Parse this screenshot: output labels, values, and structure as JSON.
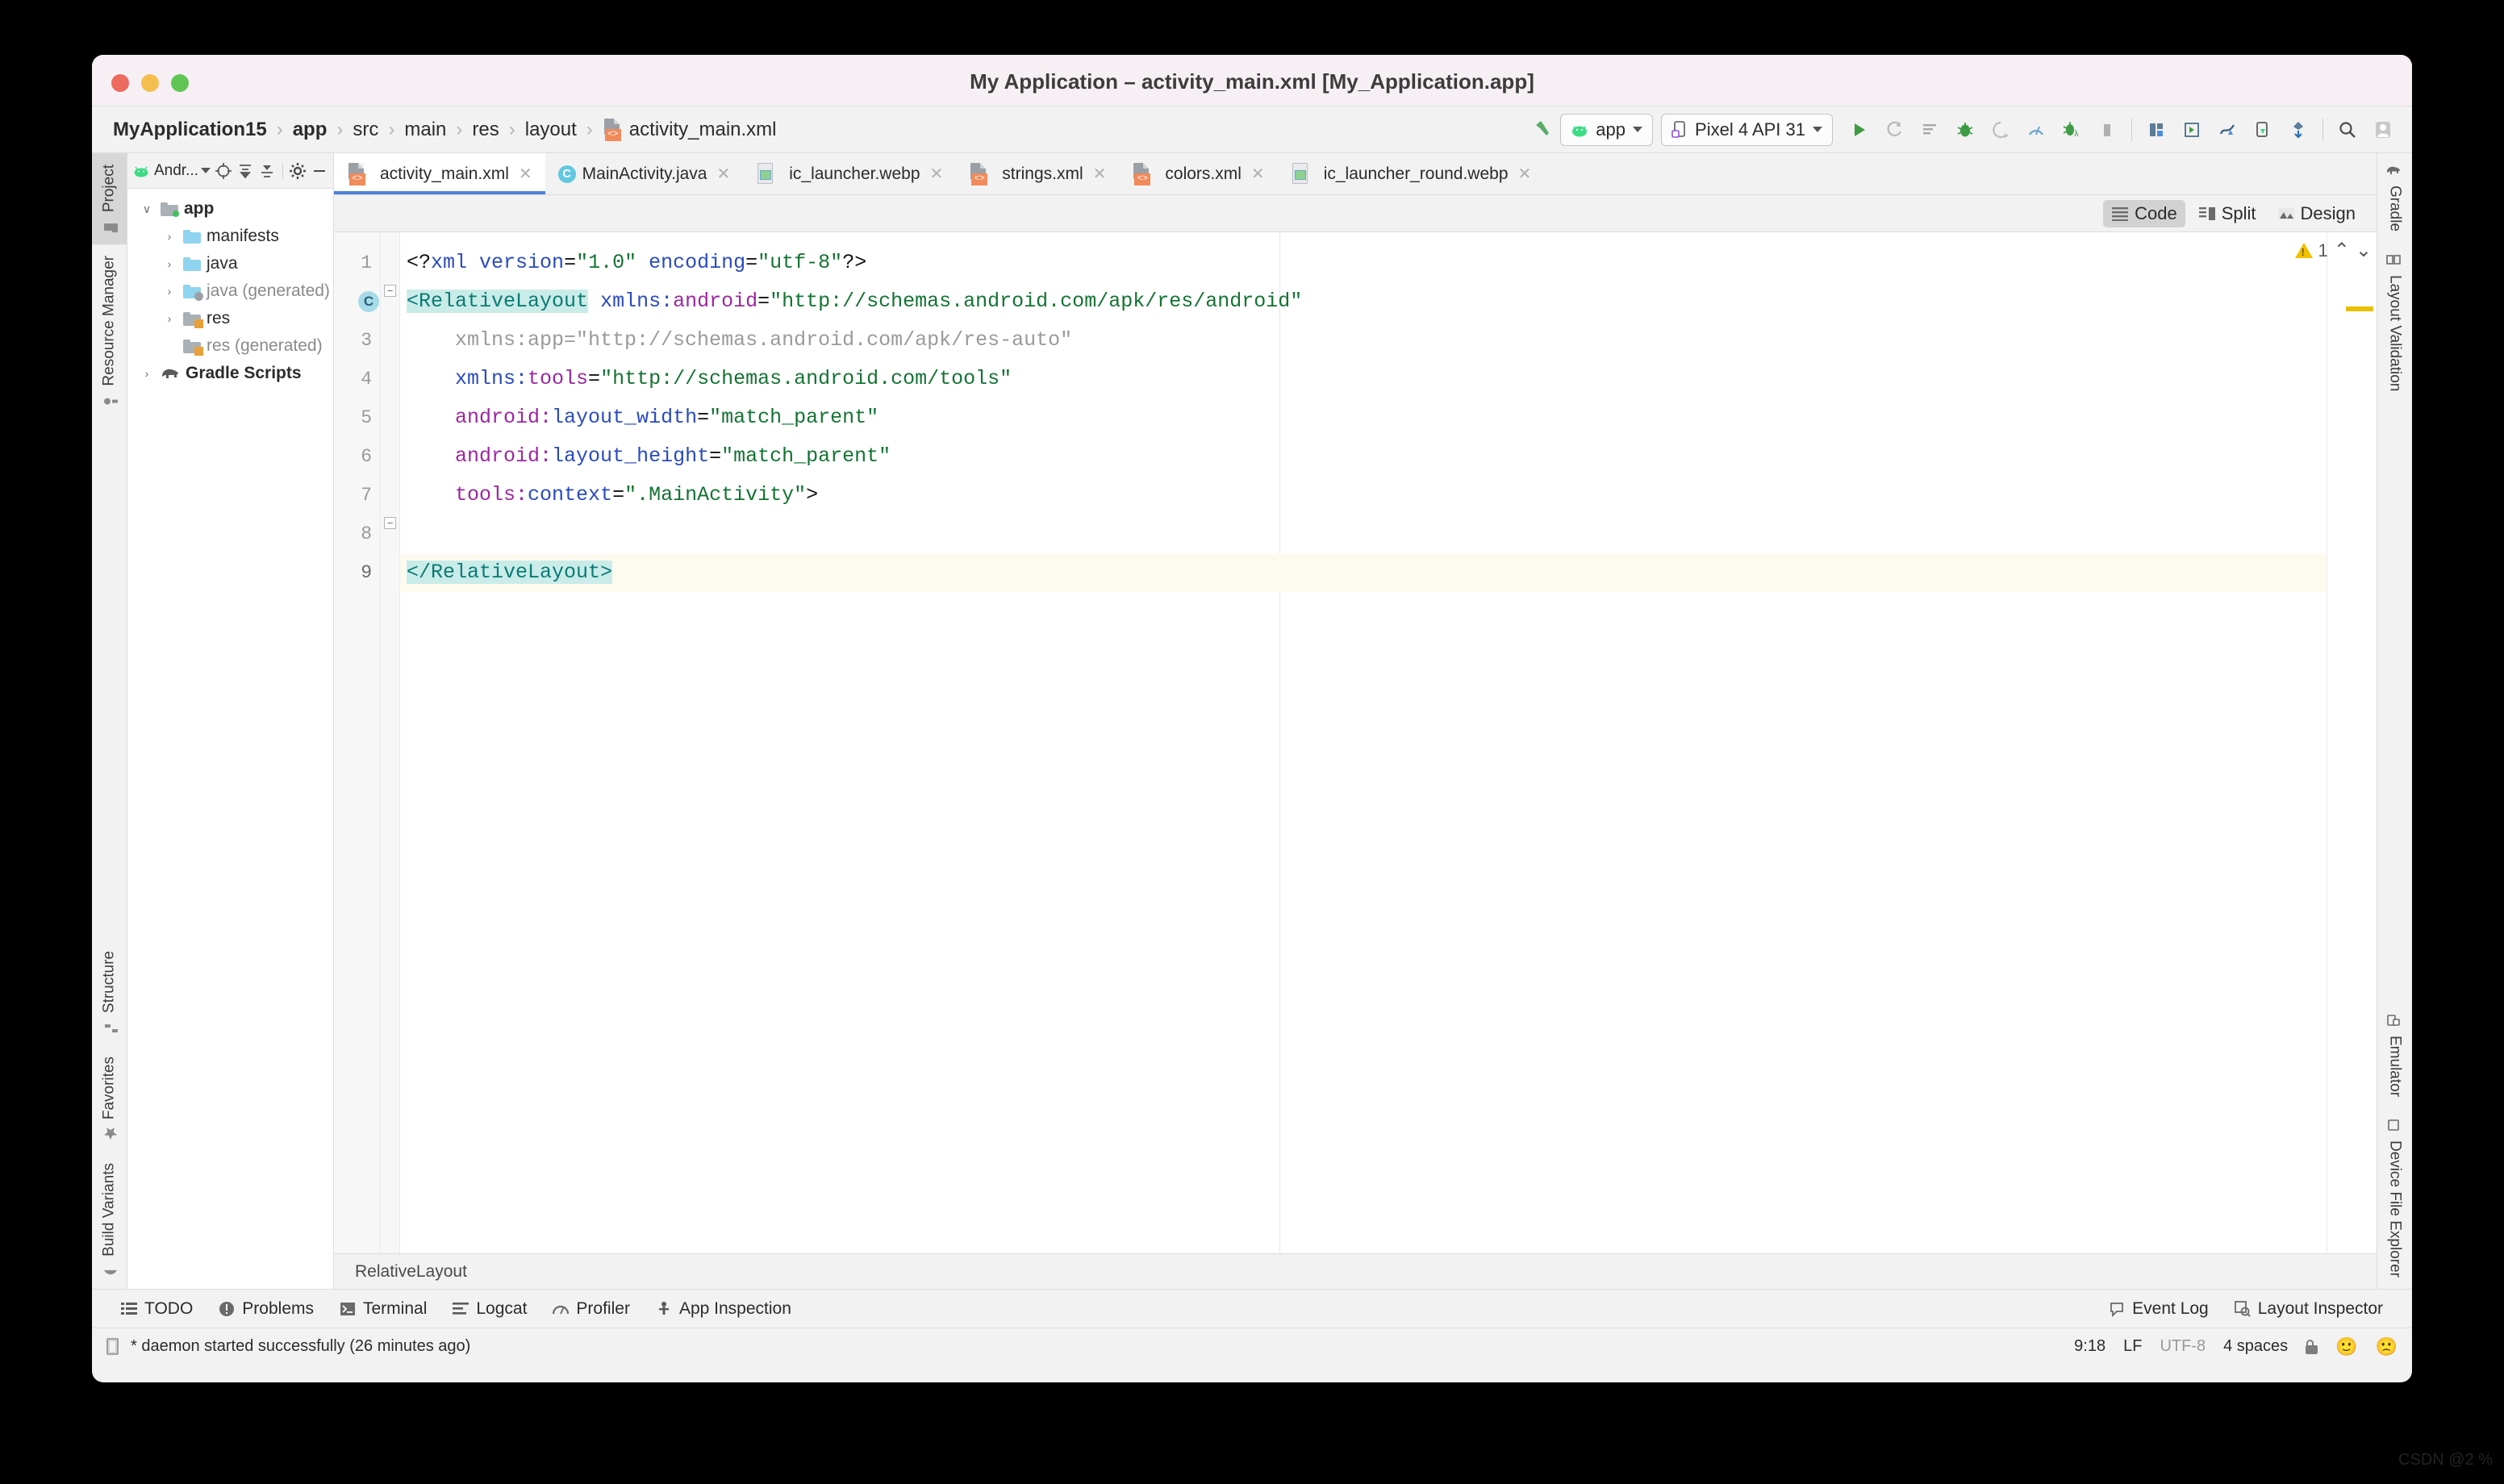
{
  "window": {
    "title": "My Application – activity_main.xml [My_Application.app]"
  },
  "breadcrumb": {
    "items": [
      "MyApplication15",
      "app",
      "src",
      "main",
      "res",
      "layout",
      "activity_main.xml"
    ],
    "separator": "›"
  },
  "toolbar": {
    "build_icon": "hammer-icon",
    "run_config": "app",
    "device": "Pixel 4 API 31",
    "actions": [
      "run-icon",
      "rerun-icon",
      "apply-changes-icon",
      "debug-icon",
      "attach-debugger-icon",
      "profiler-icon",
      "debug-attach-icon",
      "stop-icon",
      "avd-manager-icon",
      "sdk-manager-icon",
      "device-manager-icon",
      "device-explorer-icon",
      "sync-gradle-icon",
      "search-icon",
      "avatar-icon"
    ]
  },
  "left_stripe": {
    "tabs": [
      {
        "label": "Project",
        "icon": "project-icon",
        "active": true
      },
      {
        "label": "Resource Manager",
        "icon": "resource-manager-icon",
        "active": false
      },
      {
        "label": "Structure",
        "icon": "structure-icon",
        "active": false
      },
      {
        "label": "Favorites",
        "icon": "star-icon",
        "active": false
      },
      {
        "label": "Build Variants",
        "icon": "build-variants-icon",
        "active": false
      }
    ]
  },
  "right_stripe": {
    "tabs": [
      {
        "label": "Gradle",
        "icon": "gradle-elephant-icon"
      },
      {
        "label": "Layout Validation",
        "icon": "layout-validation-icon"
      },
      {
        "label": "Emulator",
        "icon": "emulator-icon"
      },
      {
        "label": "Device File Explorer",
        "icon": "device-file-explorer-icon"
      }
    ]
  },
  "project_panel": {
    "header": {
      "title": "Andr...",
      "buttons": [
        "select-opened-file-icon",
        "expand-all-icon",
        "collapse-all-icon",
        "settings-gear-icon",
        "hide-icon"
      ]
    },
    "tree": [
      {
        "label": "app",
        "indent": 0,
        "arrow": "∨",
        "icon": "folder-module",
        "bold": true,
        "dim": false
      },
      {
        "label": "manifests",
        "indent": 1,
        "arrow": "›",
        "icon": "folder-blue",
        "bold": false,
        "dim": false
      },
      {
        "label": "java",
        "indent": 1,
        "arrow": "›",
        "icon": "folder-blue",
        "bold": false,
        "dim": false
      },
      {
        "label": "java (generated)",
        "indent": 1,
        "arrow": "›",
        "icon": "folder-generated",
        "bold": false,
        "dim": true
      },
      {
        "label": "res",
        "indent": 1,
        "arrow": "›",
        "icon": "folder-res",
        "bold": false,
        "dim": false
      },
      {
        "label": "res (generated)",
        "indent": 1,
        "arrow": "",
        "icon": "folder-res",
        "bold": false,
        "dim": true
      },
      {
        "label": "Gradle Scripts",
        "indent": 0,
        "arrow": "›",
        "icon": "gradle-elephant-icon",
        "bold": true,
        "dim": false
      }
    ]
  },
  "editor_tabs": [
    {
      "label": "activity_main.xml",
      "icon": "xml-file-icon",
      "active": true
    },
    {
      "label": "MainActivity.java",
      "icon": "java-class-icon",
      "active": false
    },
    {
      "label": "ic_launcher.webp",
      "icon": "image-file-icon",
      "active": false
    },
    {
      "label": "strings.xml",
      "icon": "xml-file-icon",
      "active": false
    },
    {
      "label": "colors.xml",
      "icon": "xml-file-icon",
      "active": false
    },
    {
      "label": "ic_launcher_round.webp",
      "icon": "image-file-icon",
      "active": false
    }
  ],
  "view_modes": [
    {
      "label": "Code",
      "icon": "code-lines-icon",
      "active": true
    },
    {
      "label": "Split",
      "icon": "split-view-icon",
      "active": false
    },
    {
      "label": "Design",
      "icon": "design-view-icon",
      "active": false
    }
  ],
  "editor": {
    "warning_count": "1",
    "prev_icon": "chevron-up-icon",
    "next_icon": "chevron-down-icon",
    "line_numbers": [
      "1",
      "2",
      "3",
      "4",
      "5",
      "6",
      "7",
      "8",
      "9"
    ],
    "class_marker": "C",
    "lines": [
      {
        "n": 1,
        "segments": [
          {
            "t": "<?",
            "c": "punct"
          },
          {
            "t": "xml",
            "c": "pi"
          },
          {
            "t": " ",
            "c": "punct"
          },
          {
            "t": "version",
            "c": "attr-ns"
          },
          {
            "t": "=",
            "c": "punct"
          },
          {
            "t": "\"1.0\"",
            "c": "str"
          },
          {
            "t": " ",
            "c": "punct"
          },
          {
            "t": "encoding",
            "c": "attr-ns"
          },
          {
            "t": "=",
            "c": "punct"
          },
          {
            "t": "\"utf-8\"",
            "c": "str"
          },
          {
            "t": "?>",
            "c": "punct"
          }
        ]
      },
      {
        "n": 2,
        "segments": [
          {
            "t": "<",
            "c": "tag-sel"
          },
          {
            "t": "RelativeLayout",
            "c": "tag-sel"
          },
          {
            "t": " ",
            "c": "punct"
          },
          {
            "t": "xmlns:",
            "c": "attr-ns"
          },
          {
            "t": "android",
            "c": "attr"
          },
          {
            "t": "=",
            "c": "punct"
          },
          {
            "t": "\"http://schemas.android.com/apk/res/android\"",
            "c": "str"
          }
        ]
      },
      {
        "n": 3,
        "segments": [
          {
            "t": "    xmlns:app=\"http://schemas.android.com/apk/res-auto\"",
            "c": "dim"
          }
        ]
      },
      {
        "n": 4,
        "segments": [
          {
            "t": "    ",
            "c": "punct"
          },
          {
            "t": "xmlns:",
            "c": "attr-ns"
          },
          {
            "t": "tools",
            "c": "attr"
          },
          {
            "t": "=",
            "c": "punct"
          },
          {
            "t": "\"http://schemas.android.com/tools\"",
            "c": "str"
          }
        ]
      },
      {
        "n": 5,
        "segments": [
          {
            "t": "    ",
            "c": "punct"
          },
          {
            "t": "android:",
            "c": "attr"
          },
          {
            "t": "layout_width",
            "c": "attr-ns"
          },
          {
            "t": "=",
            "c": "punct"
          },
          {
            "t": "\"match_parent\"",
            "c": "str"
          }
        ]
      },
      {
        "n": 6,
        "segments": [
          {
            "t": "    ",
            "c": "punct"
          },
          {
            "t": "android:",
            "c": "attr"
          },
          {
            "t": "layout_height",
            "c": "attr-ns"
          },
          {
            "t": "=",
            "c": "punct"
          },
          {
            "t": "\"match_parent\"",
            "c": "str"
          }
        ]
      },
      {
        "n": 7,
        "segments": [
          {
            "t": "    ",
            "c": "punct"
          },
          {
            "t": "tools:",
            "c": "attr"
          },
          {
            "t": "context",
            "c": "attr-ns"
          },
          {
            "t": "=",
            "c": "punct"
          },
          {
            "t": "\".MainActivity\"",
            "c": "str"
          },
          {
            "t": ">",
            "c": "punct"
          }
        ]
      },
      {
        "n": 8,
        "segments": []
      },
      {
        "n": 9,
        "segments": [
          {
            "t": "</",
            "c": "tag-sel"
          },
          {
            "t": "RelativeLayout",
            "c": "tag-sel"
          },
          {
            "t": ">",
            "c": "tag-sel"
          }
        ]
      }
    ],
    "intention_bulb": "intention-bulb-icon",
    "breadcrumb": "RelativeLayout"
  },
  "bottom_tools": {
    "left": [
      {
        "label": "TODO",
        "icon": "todo-icon"
      },
      {
        "label": "Problems",
        "icon": "problems-icon"
      },
      {
        "label": "Terminal",
        "icon": "terminal-icon"
      },
      {
        "label": "Logcat",
        "icon": "logcat-icon"
      },
      {
        "label": "Profiler",
        "icon": "profiler-icon"
      },
      {
        "label": "App Inspection",
        "icon": "app-inspection-icon"
      }
    ],
    "right": [
      {
        "label": "Event Log",
        "icon": "event-log-icon"
      },
      {
        "label": "Layout Inspector",
        "icon": "layout-inspector-icon"
      }
    ]
  },
  "statusbar": {
    "message": "* daemon started successfully (26 minutes ago)",
    "message_icon": "file-icon",
    "caret_position": "9:18",
    "line_separator": "LF",
    "encoding": "UTF-8",
    "indent": "4 spaces",
    "lock_icon": "unlocked-icon",
    "happy_face": "🙂",
    "sad_face": "🙁"
  },
  "watermark": "CSDN @2 %",
  "colors": {
    "accent_blue": "#4b83d4",
    "tag_teal": "#0b7a74",
    "attr_purple": "#9c27a0",
    "string_green": "#137333",
    "warning_yellow": "#f0c000",
    "android_green": "#42c063"
  }
}
